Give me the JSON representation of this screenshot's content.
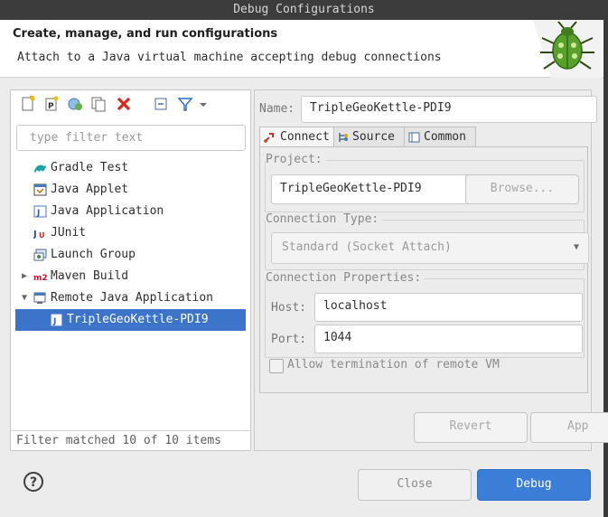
{
  "window": {
    "title": "Debug Configurations"
  },
  "header": {
    "title": "Create, manage, and run configurations",
    "subtitle": "Attach to a Java virtual machine accepting debug connections"
  },
  "left": {
    "filter_placeholder": "type filter text",
    "tree": [
      {
        "label": "Gradle Test",
        "icon": "gradle-icon"
      },
      {
        "label": "Java Applet",
        "icon": "java-applet-icon"
      },
      {
        "label": "Java Application",
        "icon": "java-application-icon"
      },
      {
        "label": "JUnit",
        "icon": "junit-icon"
      },
      {
        "label": "Launch Group",
        "icon": "launch-group-icon"
      },
      {
        "label": "Maven Build",
        "icon": "maven-icon"
      },
      {
        "label": "Remote Java Application",
        "icon": "remote-java-icon"
      },
      {
        "label": "TripleGeoKettle-PDI9",
        "icon": "config-icon"
      }
    ],
    "status": "Filter matched 10 of 10 items"
  },
  "right": {
    "name_label": "Name:",
    "name_value": "TripleGeoKettle-PDI9",
    "tabs": {
      "connect": "Connect",
      "source": "Source",
      "common": "Common"
    },
    "project_label": "Project:",
    "project_value": "TripleGeoKettle-PDI9",
    "browse": "Browse...",
    "connection_type_label": "Connection Type:",
    "connection_type_value": "Standard (Socket Attach)",
    "connection_props_label": "Connection Properties:",
    "host_label": "Host:",
    "host_value": "localhost",
    "port_label": "Port:",
    "port_value": "1044",
    "allow_termination": "Allow termination of remote VM",
    "revert": "Revert",
    "apply": "App"
  },
  "footer": {
    "help": "?",
    "close": "Close",
    "debug": "Debug"
  },
  "colors": {
    "accent": "#3a7ed8",
    "selection": "#3b74c8",
    "titlebar": "#3c3c3c"
  }
}
